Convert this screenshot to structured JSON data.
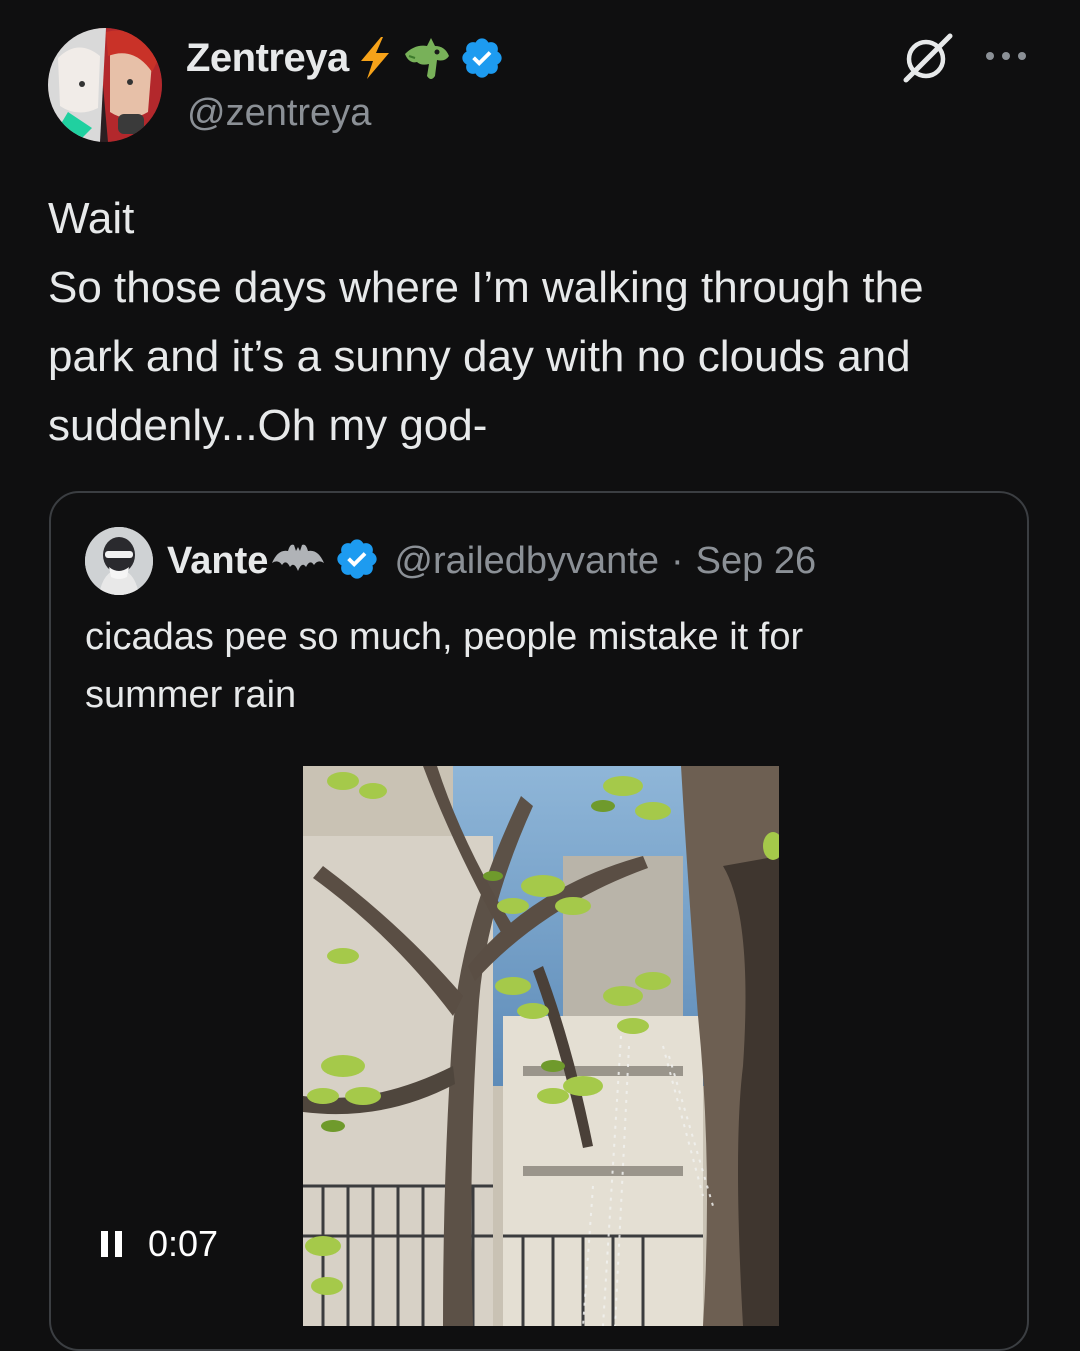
{
  "tweet": {
    "author": {
      "display_name": "Zentreya",
      "handle": "@zentreya",
      "name_emojis": [
        "lightning-icon",
        "dragon-icon"
      ],
      "verified": true
    },
    "text_lines": [
      "Wait",
      "So those days where I’m walking through the",
      "park and it’s a sunny day with no clouds and",
      "suddenly...Oh my god-"
    ]
  },
  "quote": {
    "author": {
      "display_name": "Vante",
      "name_emoji": "bat-icon",
      "handle": "@railedbyvante",
      "verified": true
    },
    "separator": "·",
    "date": "Sep 26",
    "text_lines": [
      "cicadas pee so much, people mistake it for",
      "summer rain"
    ],
    "video": {
      "state": "playing",
      "timestamp": "0:07"
    }
  },
  "colors": {
    "background": "#0f0f10",
    "text_primary": "#e7e9ea",
    "text_secondary": "#8b9096",
    "verified_blue": "#1d9bf0",
    "card_border": "#3b3e42"
  }
}
